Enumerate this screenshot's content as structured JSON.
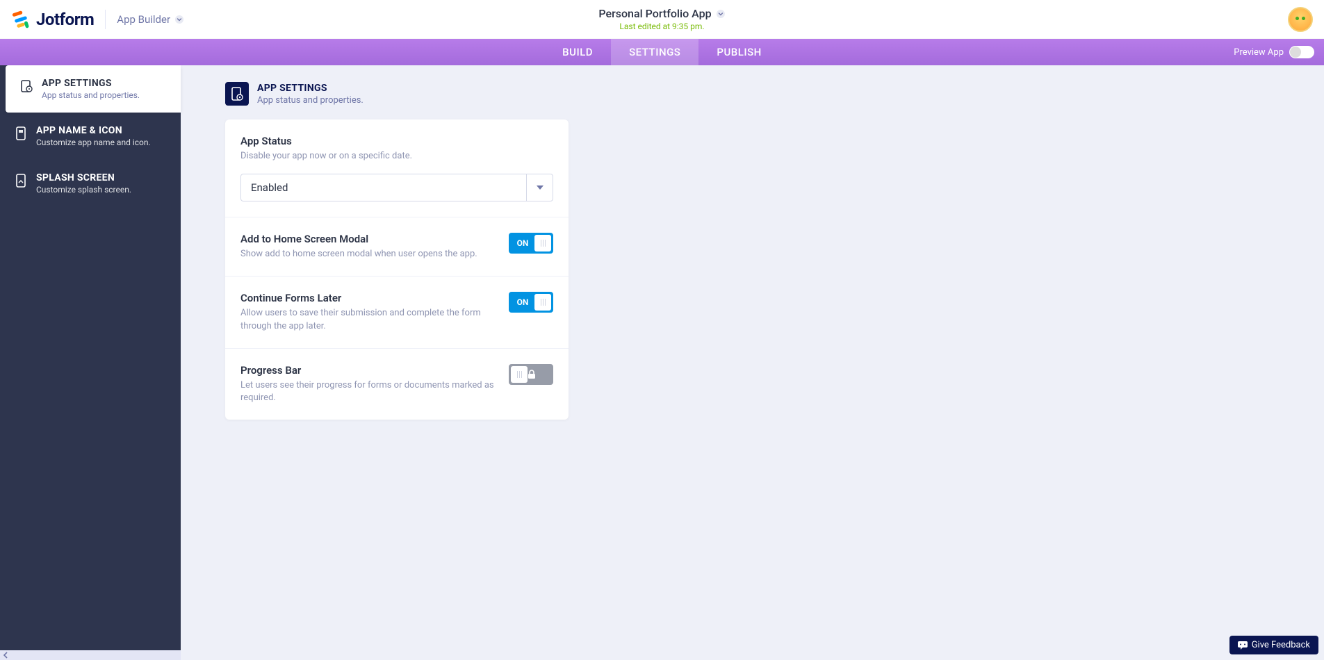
{
  "header": {
    "brand": "Jotform",
    "app_builder_label": "App Builder",
    "app_title": "Personal Portfolio App",
    "last_edited": "Last edited at 9:35 pm."
  },
  "nav": {
    "tabs": [
      {
        "label": "BUILD"
      },
      {
        "label": "SETTINGS"
      },
      {
        "label": "PUBLISH"
      }
    ],
    "preview_label": "Preview App"
  },
  "sidebar": {
    "items": [
      {
        "title": "APP SETTINGS",
        "desc": "App status and properties."
      },
      {
        "title": "APP NAME & ICON",
        "desc": "Customize app name and icon."
      },
      {
        "title": "SPLASH SCREEN",
        "desc": "Customize splash screen."
      }
    ]
  },
  "section": {
    "title": "APP SETTINGS",
    "desc": "App status and properties."
  },
  "settings": {
    "app_status": {
      "title": "App Status",
      "desc": "Disable your app now or on a specific date.",
      "value": "Enabled"
    },
    "home_modal": {
      "title": "Add to Home Screen Modal",
      "desc": "Show add to home screen modal when user opens the app.",
      "state": "ON"
    },
    "continue_later": {
      "title": "Continue Forms Later",
      "desc": "Allow users to save their submission and complete the form through the app later.",
      "state": "ON"
    },
    "progress_bar": {
      "title": "Progress Bar",
      "desc": "Let users see their progress for forms or documents marked as required."
    }
  },
  "feedback": {
    "label": "Give Feedback"
  }
}
